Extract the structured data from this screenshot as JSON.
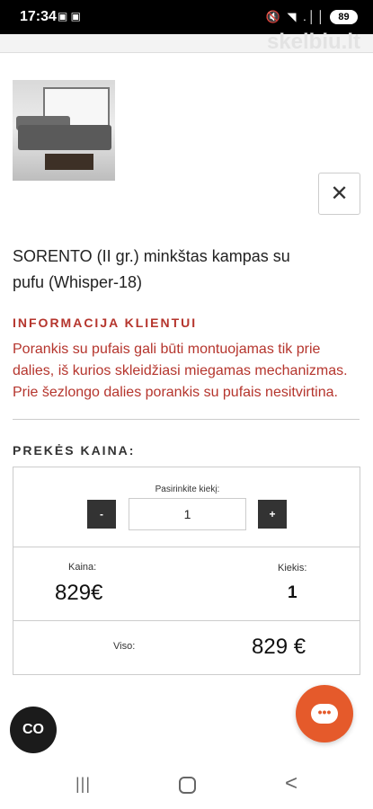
{
  "status_bar": {
    "time": "17:34",
    "left_icons": "▣ ▣",
    "right_icons": "🔇 ◥ .││",
    "battery": "89"
  },
  "watermark": "skelbiu.lt",
  "modal": {
    "close_label": "✕",
    "product_title": "SORENTO (II gr.) minkštas kampas su pufu (Whisper-18)",
    "info_heading": "INFORMACIJA KLIENTUI",
    "info_text": "Porankis su pufais gali būti montuojamas tik prie dalies, iš kurios skleidžiasi miegamas mechanizmas. Prie šezlongo dalies porankis su pufais nesitvirtina.",
    "price_heading": "PREKĖS KAINA:",
    "quantity_label": "Pasirinkite kiekį:",
    "minus_label": "-",
    "plus_label": "+",
    "quantity_value": "1",
    "price_label": "Kaina:",
    "price_value": "829€",
    "amount_label": "Kiekis:",
    "amount_value": "1",
    "total_label": "Viso:",
    "total_value": "829 €"
  },
  "floating": {
    "cookie_label": "CO",
    "chat_label": "•••"
  },
  "navbar": {
    "recent_label": "|||",
    "back_label": "<"
  }
}
